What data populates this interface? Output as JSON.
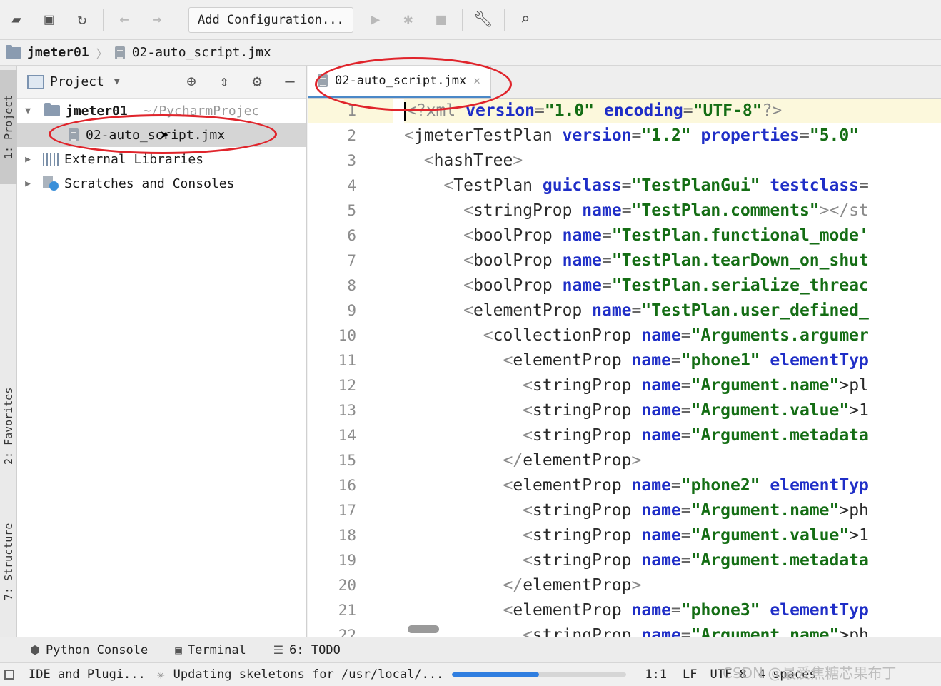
{
  "toolbar": {
    "add_config_label": "Add Configuration...",
    "icons": [
      "open-icon",
      "save-icon",
      "sync-icon",
      "back-icon",
      "forward-icon",
      "run-icon",
      "debug-icon",
      "stop-icon",
      "wrench-icon",
      "search-icon"
    ]
  },
  "breadcrumb": {
    "project": "jmeter01",
    "file": "02-auto_script.jmx"
  },
  "side_tabs": {
    "project": "1: Project",
    "favorites": "2: Favorites",
    "structure": "7: Structure"
  },
  "project_panel": {
    "title": "Project",
    "tree": {
      "root_name": "jmeter01",
      "root_path": "~/PycharmProjec",
      "file": "02-auto_script.jmx",
      "external": "External Libraries",
      "scratches": "Scratches and Consoles"
    }
  },
  "editor": {
    "tab_label": "02-auto_script.jmx",
    "line_numbers": [
      "1",
      "2",
      "3",
      "4",
      "5",
      "6",
      "7",
      "8",
      "9",
      "10",
      "11",
      "12",
      "13",
      "14",
      "15",
      "16",
      "17",
      "18",
      "19",
      "20",
      "21",
      "22"
    ]
  },
  "code": {
    "l1": {
      "open": "<?xml ",
      "a1": "version",
      "v1": "\"1.0\"",
      "a2": "encoding",
      "v2": "\"UTF-8\"",
      "close": "?>"
    },
    "l2": {
      "tag": "jmeterTestPlan",
      "a1": "version",
      "v1": "\"1.2\"",
      "a2": "properties",
      "v2": "\"5.0\""
    },
    "l3": {
      "tag": "hashTree"
    },
    "l4": {
      "tag": "TestPlan",
      "a1": "guiclass",
      "v1": "\"TestPlanGui\"",
      "a2": "testclass"
    },
    "l5": {
      "tag": "stringProp",
      "a1": "name",
      "v1": "\"TestPlan.comments\"",
      "rest": "></st"
    },
    "l6": {
      "tag": "boolProp",
      "a1": "name",
      "v1": "\"TestPlan.functional_mode'"
    },
    "l7": {
      "tag": "boolProp",
      "a1": "name",
      "v1": "\"TestPlan.tearDown_on_shut"
    },
    "l8": {
      "tag": "boolProp",
      "a1": "name",
      "v1": "\"TestPlan.serialize_threac"
    },
    "l9": {
      "tag": "elementProp",
      "a1": "name",
      "v1": "\"TestPlan.user_defined_"
    },
    "l10": {
      "tag": "collectionProp",
      "a1": "name",
      "v1": "\"Arguments.argumer"
    },
    "l11": {
      "tag": "elementProp",
      "a1": "name",
      "v1": "\"phone1\"",
      "a2": "elementTyp"
    },
    "l12": {
      "tag": "stringProp",
      "a1": "name",
      "v1": "\"Argument.name\"",
      "rest": ">pl"
    },
    "l13": {
      "tag": "stringProp",
      "a1": "name",
      "v1": "\"Argument.value\"",
      "rest": ">1"
    },
    "l14": {
      "tag": "stringProp",
      "a1": "name",
      "v1": "\"Argument.metadata"
    },
    "l15": {
      "tag": "elementProp"
    },
    "l16": {
      "tag": "elementProp",
      "a1": "name",
      "v1": "\"phone2\"",
      "a2": "elementTyp"
    },
    "l17": {
      "tag": "stringProp",
      "a1": "name",
      "v1": "\"Argument.name\"",
      "rest": ">ph"
    },
    "l18": {
      "tag": "stringProp",
      "a1": "name",
      "v1": "\"Argument.value\"",
      "rest": ">1"
    },
    "l19": {
      "tag": "stringProp",
      "a1": "name",
      "v1": "\"Argument.metadata"
    },
    "l20": {
      "tag": "elementProp"
    },
    "l21": {
      "tag": "elementProp",
      "a1": "name",
      "v1": "\"phone3\"",
      "a2": "elementTyp"
    },
    "l22": {
      "tag": "stringProp",
      "a1": "name",
      "v1": "\"Argument.name\"",
      "rest": ">ph"
    }
  },
  "bottom_tabs": {
    "python_console": "Python Console",
    "terminal": "Terminal",
    "todo_num": "6",
    "todo": ": TODO"
  },
  "status": {
    "ide_plugins": "IDE and Plugi...",
    "task": "Updating skeletons for /usr/local/...",
    "progress": 0.5,
    "position": "1:1",
    "line_sep": "LF",
    "encoding": "UTF-8",
    "indent": "4 spaces",
    "watermark": "CSDN @最爱焦糖芯果布丁"
  },
  "colors": {
    "annotation": "#e0242b",
    "progress": "#2f7ee0",
    "attr": "#1f2ec7",
    "string": "#146d14"
  }
}
